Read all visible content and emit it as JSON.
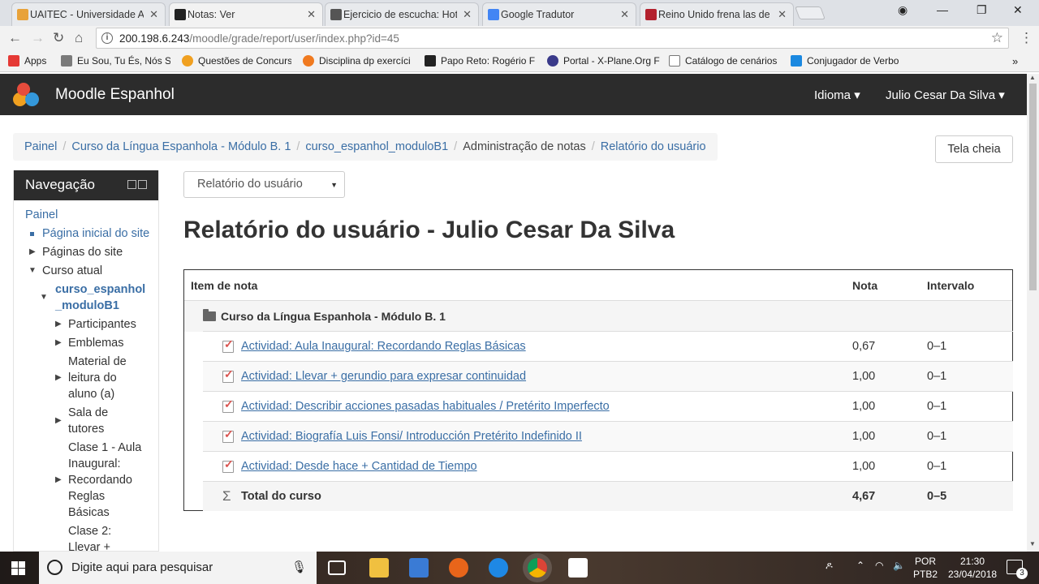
{
  "browser": {
    "tabs": [
      {
        "title": "UAITEC - Universidade A",
        "color": "#e8a23a"
      },
      {
        "title": "Notas: Ver",
        "color": "#222222"
      },
      {
        "title": "Ejercicio de escucha: Hot",
        "color": "#555555"
      },
      {
        "title": "Google Tradutor",
        "color": "#4285f4"
      },
      {
        "title": "Reino Unido frena las de",
        "color": "#b3212e"
      }
    ],
    "url_host": "200.198.6.243",
    "url_path": "/moodle/grade/report/user/index.php?id=45",
    "bookmarks": [
      {
        "label": "Apps",
        "color": "#e53935"
      },
      {
        "label": "Eu Sou, Tu És, Nós Sc",
        "color": "#7a7a7a"
      },
      {
        "label": "Questões de Concurs",
        "color": "#f0a020"
      },
      {
        "label": "Disciplina dp exercíci",
        "color": "#f07a20"
      },
      {
        "label": "Papo Reto: Rogério F",
        "color": "#222222"
      },
      {
        "label": "Portal - X-Plane.Org F",
        "color": "#3a3a8a"
      },
      {
        "label": "Catálogo de cenários",
        "color": "#dddddd"
      },
      {
        "label": "Conjugador de Verbo",
        "color": "#1a88e0"
      }
    ]
  },
  "moodle": {
    "site_name": "Moodle Espanhol",
    "language_menu": "Idioma",
    "user_menu": "Julio Cesar Da Silva",
    "breadcrumb": [
      "Painel",
      "Curso da Língua Espanhola - Módulo B. 1",
      "curso_espanhol_moduloB1",
      "Administração de notas",
      "Relatório do usuário"
    ],
    "fullscreen_label": "Tela cheia",
    "navigation": {
      "title": "Navegação",
      "painel": "Painel",
      "home": "Página inicial do site",
      "site_pages": "Páginas do site",
      "current_course": "Curso atual",
      "course_short_1": "curso_espanhol",
      "course_short_2": "_moduloB1",
      "participants": "Participantes",
      "badges": "Emblemas",
      "material_1": "Material de",
      "material_2": "leitura do",
      "material_3": "aluno (a)",
      "tutors_1": "Sala de",
      "tutors_2": "tutores",
      "clase1_1": "Clase 1 - Aula",
      "clase1_2": "Inaugural:",
      "clase1_3": "Recordando",
      "clase1_4": "Reglas",
      "clase1_5": "Básicas",
      "clase2_1": "Clase 2:",
      "clase2_2": "Llevar +"
    },
    "report_select": "Relatório do usuário",
    "heading": "Relatório do usuário - Julio Cesar Da Silva",
    "table": {
      "col_item": "Item de nota",
      "col_grade": "Nota",
      "col_range": "Intervalo",
      "category": "Curso da Língua Espanhola - Módulo B. 1",
      "items": [
        {
          "name": "Actividad: Aula Inaugural: Recordando Reglas Básicas",
          "grade": "0,67",
          "range": "0–1"
        },
        {
          "name": "Actividad: Llevar + gerundio para expresar continuidad",
          "grade": "1,00",
          "range": "0–1"
        },
        {
          "name": "Actividad: Describir acciones pasadas habituales / Pretérito Imperfecto",
          "grade": "1,00",
          "range": "0–1"
        },
        {
          "name": "Actividad: Biografía Luis Fonsi/ Introducción Pretérito Indefinido II",
          "grade": "1,00",
          "range": "0–1"
        },
        {
          "name": "Actividad: Desde hace + Cantidad de Tiempo",
          "grade": "1,00",
          "range": "0–1"
        }
      ],
      "total_label": "Total do curso",
      "total_grade": "4,67",
      "total_range": "0–5"
    }
  },
  "taskbar": {
    "search_placeholder": "Digite aqui para pesquisar",
    "lang_1": "POR",
    "lang_2": "PTB2",
    "time": "21:30",
    "date": "23/04/2018",
    "notifications": "3"
  }
}
